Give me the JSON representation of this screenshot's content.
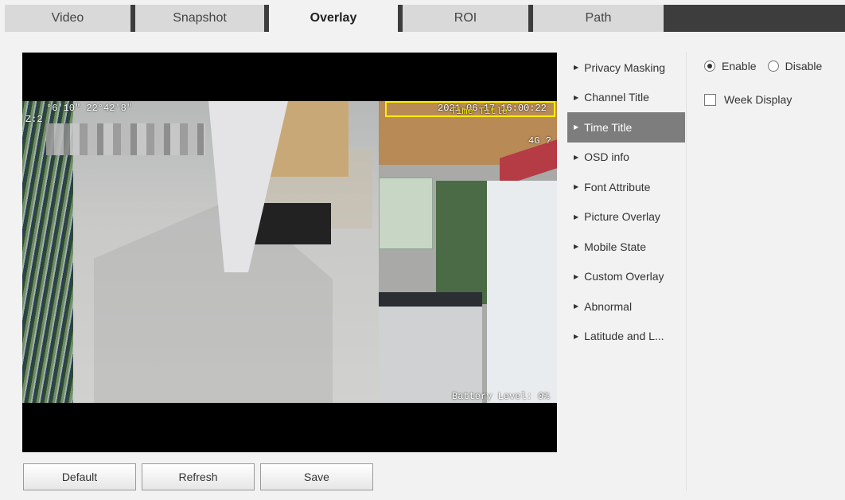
{
  "tabs": [
    {
      "label": "Video",
      "active": false
    },
    {
      "label": "Snapshot",
      "active": false
    },
    {
      "label": "Overlay",
      "active": true
    },
    {
      "label": "ROI",
      "active": false
    },
    {
      "label": "Path",
      "active": false
    }
  ],
  "preview": {
    "osd_coords": "°6'10\" 22°42'8\"",
    "osd_zoom": "Z:2",
    "osd_timestamp": "2021-06-17 16:00:22",
    "osd_time_title": "Time Title",
    "osd_signal": "4G ?",
    "osd_battery": "Battery Level: 0%",
    "time_box_color": "#ffee00"
  },
  "menu": {
    "items": [
      {
        "label": "Privacy Masking",
        "active": false
      },
      {
        "label": "Channel Title",
        "active": false
      },
      {
        "label": "Time Title",
        "active": true
      },
      {
        "label": "OSD info",
        "active": false
      },
      {
        "label": "Font Attribute",
        "active": false
      },
      {
        "label": "Picture Overlay",
        "active": false
      },
      {
        "label": "Mobile State",
        "active": false
      },
      {
        "label": "Custom Overlay",
        "active": false
      },
      {
        "label": "Abnormal",
        "active": false
      },
      {
        "label": "Latitude and L...",
        "active": false
      }
    ],
    "active_color": "#7d7d7d"
  },
  "settings": {
    "enable_label": "Enable",
    "disable_label": "Disable",
    "enabled": true,
    "week_display_label": "Week Display",
    "week_display_checked": false
  },
  "buttons": {
    "default_label": "Default",
    "refresh_label": "Refresh",
    "save_label": "Save"
  }
}
